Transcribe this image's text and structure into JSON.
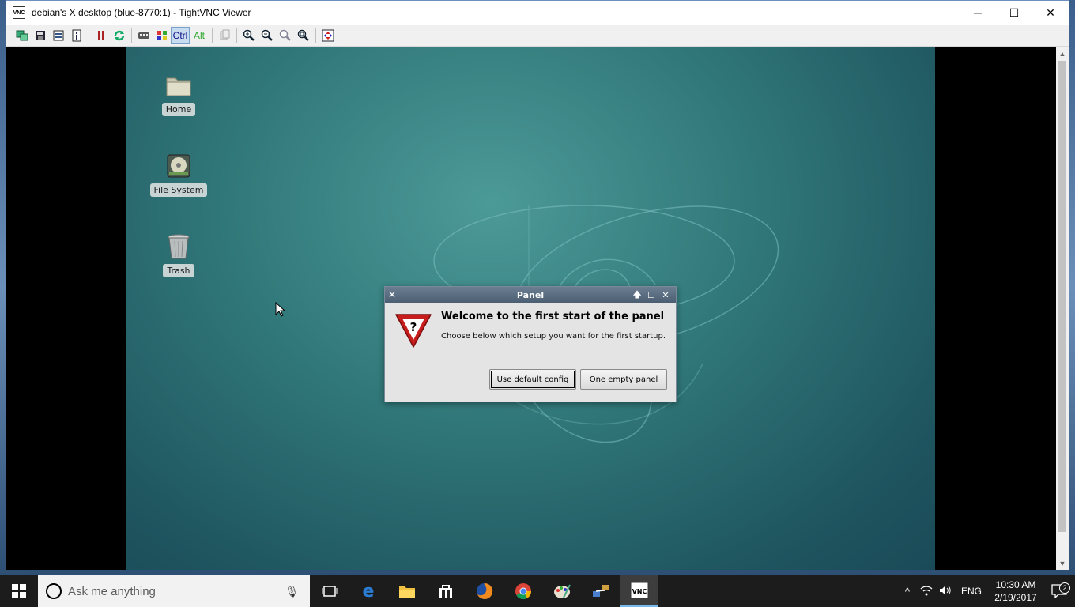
{
  "viewer": {
    "title": "debian's X desktop (blue-8770:1) - TightVNC Viewer",
    "app_icon_text": "VNC",
    "minimize": "─",
    "maximize": "☐",
    "close": "✕"
  },
  "toolbar": {
    "ctrl_label": "Ctrl",
    "alt_label": "Alt"
  },
  "desktop_icons": [
    {
      "label": "Home"
    },
    {
      "label": "File System"
    },
    {
      "label": "Trash"
    }
  ],
  "dialog": {
    "title": "Panel",
    "heading": "Welcome to the first start of the panel",
    "subtext": "Choose below which setup you want for the first startup.",
    "default_button": "Use default config",
    "empty_button": "One empty panel"
  },
  "taskbar": {
    "search_placeholder": "Ask me anything",
    "language": "ENG",
    "time": "10:30 AM",
    "date": "2/19/2017",
    "notification_count": "2"
  }
}
